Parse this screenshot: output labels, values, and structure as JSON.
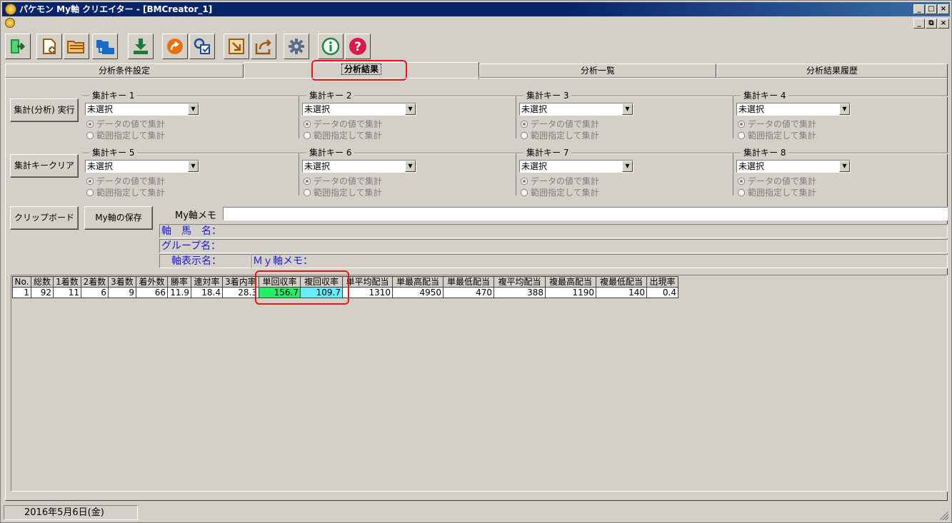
{
  "window": {
    "title": "パケモン My軸 クリエイター - [BMCreator_1]"
  },
  "title_buttons": {
    "minimize": "_",
    "maximize": "□",
    "close": "×",
    "restore": "⧉"
  },
  "toolbar": {
    "icons": [
      "exit-icon",
      "new-file-icon",
      "open-folder-icon",
      "move-folder-icon",
      "download-icon",
      "go-arrow-icon",
      "search-select-icon",
      "import-icon",
      "export-icon",
      "gear-icon",
      "info-icon",
      "help-icon"
    ],
    "colors": {
      "green": "#1a9a3a",
      "brown": "#9a5a10",
      "blue": "#1a6ac8",
      "orange": "#e87010",
      "gray": "#5a6a8a",
      "red": "#d81a4a"
    }
  },
  "tabs": [
    {
      "label": "分析条件設定"
    },
    {
      "label": "分析結果"
    },
    {
      "label": "分析一覧"
    },
    {
      "label": "分析結果履歴"
    }
  ],
  "buttons": {
    "run": "集計(分析) 実行",
    "clear": "集計キークリア",
    "clipboard": "クリップボード",
    "save": "My軸の保存"
  },
  "keys": [
    {
      "title": "集計キー 1",
      "value": "未選択"
    },
    {
      "title": "集計キー 2",
      "value": "未選択"
    },
    {
      "title": "集計キー 3",
      "value": "未選択"
    },
    {
      "title": "集計キー 4",
      "value": "未選択"
    },
    {
      "title": "集計キー 5",
      "value": "未選択"
    },
    {
      "title": "集計キー 6",
      "value": "未選択"
    },
    {
      "title": "集計キー 7",
      "value": "未選択"
    },
    {
      "title": "集計キー 8",
      "value": "未選択"
    }
  ],
  "radio": {
    "by_value": "データの値で集計",
    "by_range": "範囲指定して集計"
  },
  "memo": {
    "label": "My軸メモ",
    "value": ""
  },
  "info": {
    "horse": "軸　馬　名：",
    "group": "グループ名：",
    "display": "軸表示名：",
    "my_memo": "Ｍｙ軸メモ："
  },
  "grid": {
    "headers": [
      "No.",
      "総数",
      "1着数",
      "2着数",
      "3着数",
      "着外数",
      "勝率",
      "連対率",
      "3着内率",
      "単回収率",
      "複回収率",
      "単平均配当",
      "単最高配当",
      "単最低配当",
      "複平均配当",
      "複最高配当",
      "複最低配当",
      "出現率"
    ],
    "rows": [
      [
        "1",
        "92",
        "11",
        "6",
        "9",
        "66",
        "11.9",
        "18.4",
        "28.3",
        "156.7",
        "109.7",
        "1310",
        "4950",
        "470",
        "388",
        "1190",
        "140",
        "0.4"
      ]
    ],
    "highlight_colors": {
      "win_return": "#22ee66",
      "place_return": "#66eeff"
    }
  },
  "status": {
    "date": "2016年5月6日(金)"
  }
}
